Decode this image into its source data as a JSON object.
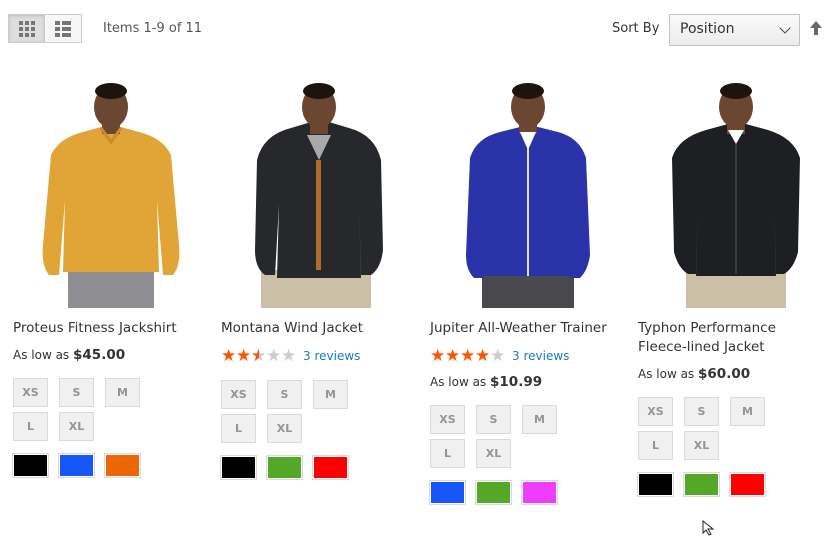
{
  "toolbar": {
    "modes": [
      {
        "name": "Grid",
        "active": true
      },
      {
        "name": "List",
        "active": false
      }
    ],
    "amount": "Items 1-9 of 11",
    "sort_label": "Sort By",
    "sort_value": "Position",
    "sort_direction_icon": "arrow-up-icon"
  },
  "products": [
    {
      "name": "Proteus Fitness Jackshirt",
      "jacket_color": "#e1a437",
      "price_label": "As low as",
      "price": "$45.00",
      "sizes": [
        "XS",
        "S",
        "M",
        "L",
        "XL"
      ],
      "colors": [
        "#000000",
        "#1857f7",
        "#eb6703"
      ]
    },
    {
      "name": "Montana Wind Jacket",
      "jacket_color": "#26282c",
      "rating": 2.5,
      "reviews": "3 reviews",
      "sizes": [
        "XS",
        "S",
        "M",
        "L",
        "XL"
      ],
      "colors": [
        "#000000",
        "#53a828",
        "#ff0000"
      ]
    },
    {
      "name": "Jupiter All-Weather Trainer",
      "jacket_color": "#2a33a8",
      "rating": 4,
      "reviews": "3 reviews",
      "price_label": "As low as",
      "price": "$10.99",
      "sizes": [
        "XS",
        "S",
        "M",
        "L",
        "XL"
      ],
      "colors": [
        "#1857f7",
        "#53a828",
        "#ef3dff"
      ]
    },
    {
      "name_lines": [
        "Typhon Performance",
        "Fleece-lined Jacket"
      ],
      "jacket_color": "#1e1f22",
      "price_label": "As low as",
      "price": "$60.00",
      "sizes": [
        "XS",
        "S",
        "M",
        "L",
        "XL"
      ],
      "colors": [
        "#000000",
        "#53a828",
        "#ff0000"
      ]
    }
  ],
  "colors": {
    "star_active": "#ff5501",
    "star_inactive": "#cccccc",
    "link": "#1979c3"
  }
}
